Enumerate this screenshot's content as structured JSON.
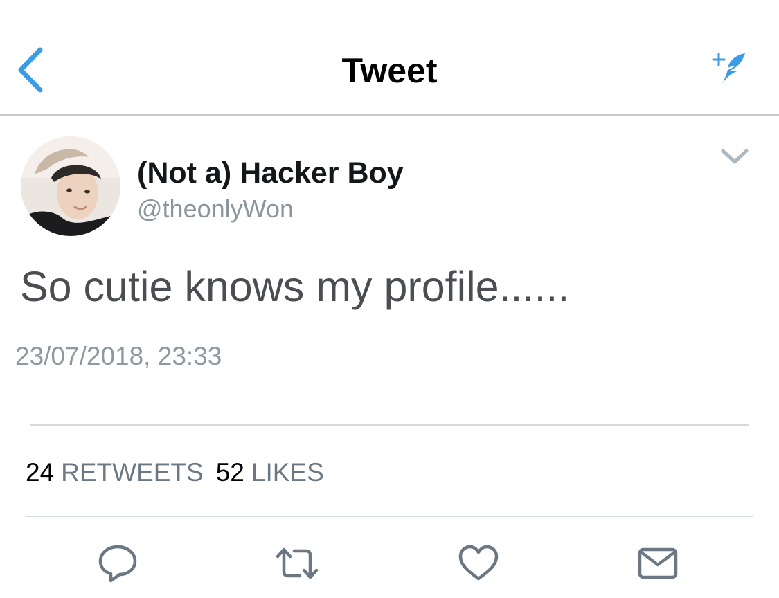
{
  "header": {
    "title": "Tweet",
    "back_icon": "chevron-left-icon",
    "compose_icon": "compose-feather-icon",
    "accent_color": "#1da1f2"
  },
  "tweet": {
    "author": {
      "name": "(Not a) Hacker Boy",
      "handle": "@theonlyWon"
    },
    "text": "So cutie knows my profile......",
    "timestamp": "23/07/2018, 23:33",
    "menu_icon": "chevron-down-icon"
  },
  "stats": {
    "retweets_count": "24",
    "retweets_label": "RETWEETS",
    "likes_count": "52",
    "likes_label": "LIKES"
  },
  "actions": {
    "icons": [
      "reply-icon",
      "retweet-icon",
      "like-icon",
      "share-icon"
    ],
    "icon_color": "#6b7884"
  }
}
